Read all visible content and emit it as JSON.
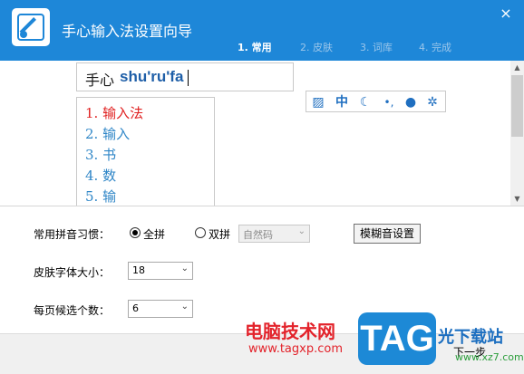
{
  "window": {
    "title": "手心输入法设置向导",
    "close_glyph": "×",
    "steps": [
      "1. 常用",
      "2. 皮肤",
      "3. 词库",
      "4. 完成"
    ]
  },
  "preview": {
    "composition_hanzi": "手心",
    "composition_pinyin": "shu'ru'fa",
    "candidates": [
      "1. 输入法",
      "2. 输入",
      "3. 书",
      "4. 数",
      "5. 输"
    ],
    "toolbar_icons": [
      "ime-logo-icon",
      "chinese-mode-icon",
      "moon-icon",
      "punctuation-icon",
      "user-icon",
      "gear-icon"
    ],
    "toolbar_glyphs": [
      "▨",
      "中",
      "☾",
      "•,",
      "●",
      "✲"
    ]
  },
  "settings": {
    "pinyin_habit_label": "常用拼音习惯：",
    "full_pinyin_label": "全拼",
    "double_pinyin_label": "双拼",
    "double_pinyin_scheme": "自然码",
    "fuzzy_button": "模糊音设置",
    "font_size_label": "皮肤字体大小：",
    "font_size_value": "18",
    "candidates_label": "每页候选个数：",
    "candidates_value": "6"
  },
  "footer": {
    "next_button": "下一步"
  },
  "watermark": {
    "site_name": "电脑技术网",
    "site_url": "www.tagxp.com",
    "badge": "TAG",
    "brand": "光下载站",
    "brand_url": "www.xz7.com"
  },
  "colors": {
    "header": "#1e87d8",
    "candidate_first": "#e02020",
    "candidate": "#2f86c7",
    "pinyin": "#1f5fa8"
  }
}
